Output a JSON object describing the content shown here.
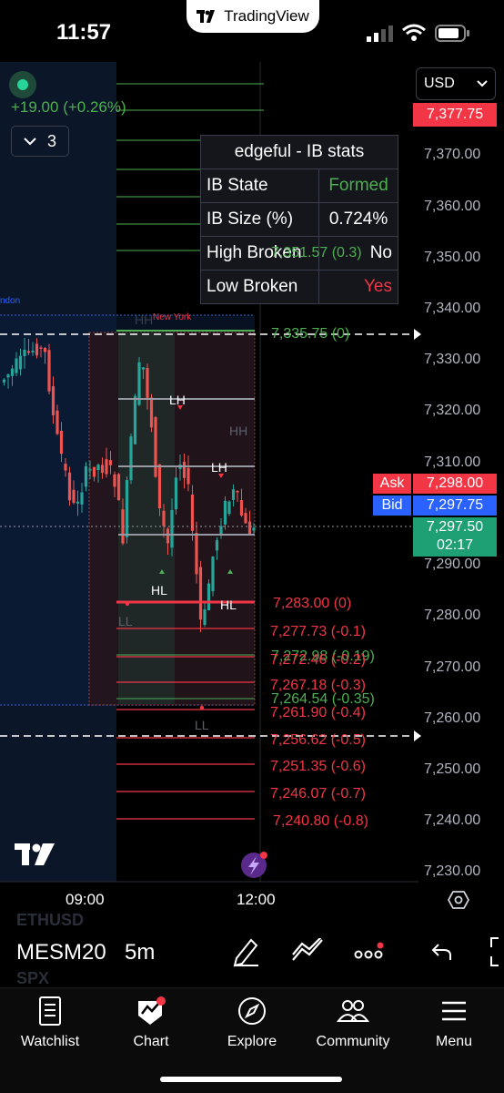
{
  "status": {
    "time": "11:57",
    "app_pill": "TradingView"
  },
  "symbol_info": {
    "change": "+19.00 (+0.26%)",
    "collapse_count": "3"
  },
  "currency": {
    "selected": "USD"
  },
  "stats": {
    "title": "edgeful - IB stats",
    "rows": [
      {
        "label": "IB State",
        "value": "Formed",
        "color": "#4caf50"
      },
      {
        "label": "IB Size (%)",
        "value": "0.724%",
        "color": "#ffffff"
      },
      {
        "label": "High Broken",
        "value": "No",
        "color": "#ffffff"
      },
      {
        "label": "Low Broken",
        "value": "Yes",
        "color": "#f23645"
      }
    ]
  },
  "price_axis": {
    "ticks": [
      "7,370.00",
      "7,360.00",
      "7,350.00",
      "7,340.00",
      "7,330.00",
      "7,320.00",
      "7,310.00",
      "7,290.00",
      "7,280.00",
      "7,270.00",
      "7,260.00",
      "7,250.00",
      "7,240.00",
      "7,230.00"
    ],
    "last_price": "7,377.75",
    "ask_label": "Ask",
    "ask_price": "7,298.00",
    "bid_label": "Bid",
    "bid_price": "7,297.75",
    "current_price": "7,297.50",
    "countdown": "02:17"
  },
  "levels_green": [
    "7,351.57 (0.3)",
    "7,335.75 (0)",
    "7,272.98 (-0.19)",
    "7,264.54 (-0.35)"
  ],
  "levels_red": [
    "7,283.00 (0)",
    "7,277.73 (-0.1)",
    "7,272.46 (-0.2)",
    "7,267.18 (-0.3)",
    "7,261.90 (-0.4)",
    "7,256.62 (-0.5)",
    "7,251.35 (-0.6)",
    "7,246.07 (-0.7)",
    "7,240.80 (-0.8)"
  ],
  "chart_labels": {
    "session_london": "ndon",
    "session_ny": "New York",
    "hh1": "HH",
    "lh1": "LH",
    "hh2": "HH",
    "lh2": "LH",
    "hl1": "HL",
    "hl2": "HL",
    "ll1": "LL",
    "ll2": "LL"
  },
  "time_axis": {
    "t1": "09:00",
    "t2": "12:00"
  },
  "toolbar": {
    "symbol": "MESM20",
    "interval": "5m",
    "ghost_above": "ETHUSD",
    "ghost_below": "SPX"
  },
  "tabs": [
    {
      "label": "Watchlist",
      "icon": "watchlist-icon"
    },
    {
      "label": "Chart",
      "icon": "chart-icon"
    },
    {
      "label": "Explore",
      "icon": "compass-icon"
    },
    {
      "label": "Community",
      "icon": "community-icon"
    },
    {
      "label": "Menu",
      "icon": "menu-icon"
    }
  ],
  "colors": {
    "green": "#4caf50",
    "red": "#f23645",
    "blue": "#2962ff",
    "bid": "#2962ff",
    "ask": "#f23645",
    "price_green": "#1e9f74"
  }
}
